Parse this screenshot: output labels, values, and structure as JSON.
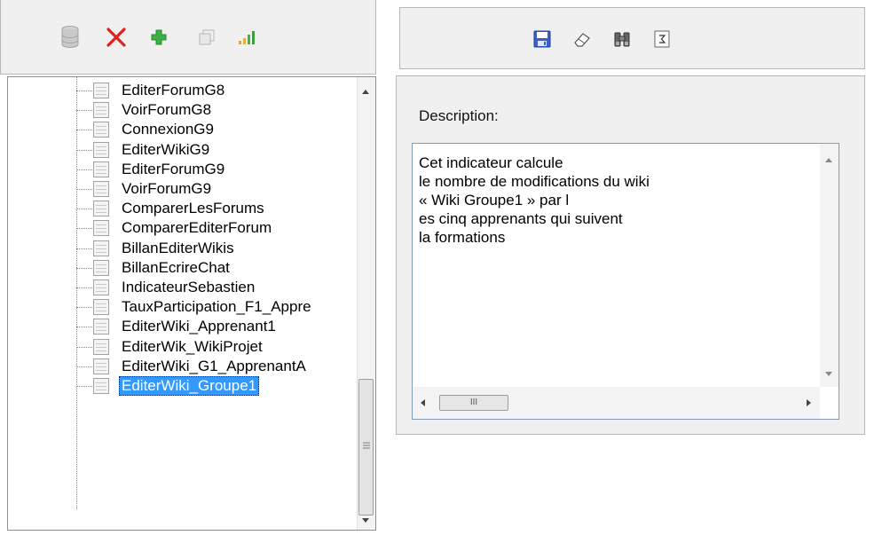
{
  "left_toolbar": {
    "icons": [
      "database-icon",
      "delete-icon",
      "add-icon",
      "copy-icon",
      "chart-icon"
    ]
  },
  "tree": {
    "items": [
      "EditerForumG8",
      "VoirForumG8",
      "ConnexionG9",
      "EditerWikiG9",
      "EditerForumG9",
      "VoirForumG9",
      "ComparerLesForums",
      "ComparerEditerForum",
      "BillanEditerWikis",
      "BillanEcrireChat",
      "IndicateurSebastien",
      "TauxParticipation_F1_Appre",
      "EditerWiki_Apprenant1",
      "EditerWik_WikiProjet",
      "EditerWiki_G1_ApprenantA",
      "EditerWiki_Groupe1"
    ],
    "selected_index": 15
  },
  "right_toolbar": {
    "icons": [
      "save-icon",
      "eraser-icon",
      "binoculars-icon",
      "sigma-icon"
    ]
  },
  "description": {
    "label": "Description:",
    "text": "Cet indicateur calcule\nle nombre de modifications du wiki\n« Wiki Groupe1 » par l\nes cinq apprenants qui suivent\nla formations"
  },
  "colors": {
    "selection": "#3399ff",
    "delete": "#e02020",
    "add": "#3cb043"
  }
}
